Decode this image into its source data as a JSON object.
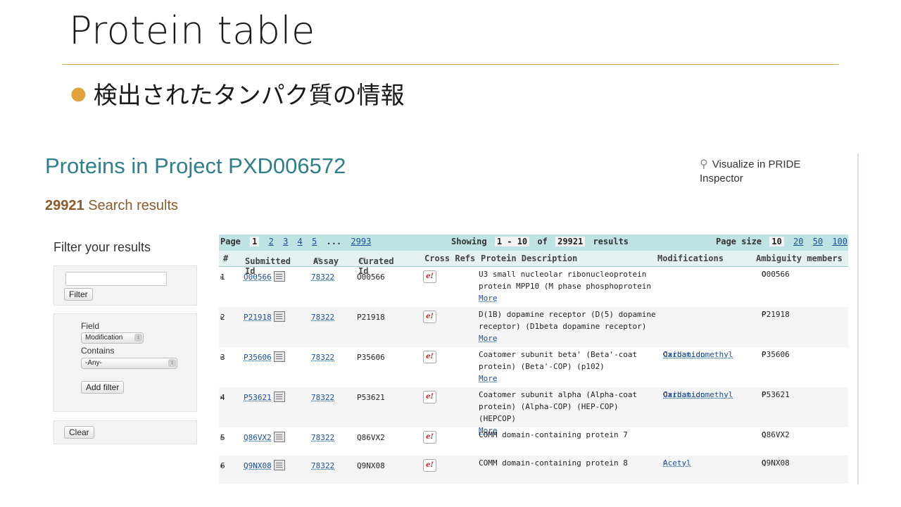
{
  "slide": {
    "title": "Protein table",
    "bullet": "検出されたタンパク質の情報"
  },
  "page": {
    "project_title": "Proteins in Project PXD006572",
    "visualize_label": "Visualize in PRIDE Inspector",
    "results_count": "29921",
    "results_label": "Search results"
  },
  "filters": {
    "heading": "Filter your results",
    "search_value": "",
    "filter_button": "Filter",
    "field_label": "Field",
    "field_value": "Modification",
    "contains_label": "Contains",
    "contains_value": "-Any-",
    "add_filter_button": "Add filter",
    "clear_button": "Clear"
  },
  "pager": {
    "page_label": "Page",
    "current_page": "1",
    "pages": [
      "2",
      "3",
      "4",
      "5"
    ],
    "ellipsis": "...",
    "last_page": "2993",
    "showing_label": "Showing",
    "range": "1 - 10",
    "of_label": "of",
    "total": "29921",
    "results_label": "results",
    "page_size_label": "Page size",
    "page_size_current": "10",
    "page_size_options": [
      "20",
      "50",
      "100"
    ]
  },
  "columns": {
    "num": "#",
    "submitted_id": "Submitted Id",
    "assay": "Assay",
    "curated_id": "Curated Id",
    "cross_refs": "Cross Refs",
    "description": "Protein Description",
    "modifications": "Modifications",
    "ambiguity": "Ambiguity members"
  },
  "rows": [
    {
      "num": "1",
      "submitted_id": "O00566",
      "assay": "78322",
      "curated_id": "O00566",
      "desc": "U3 small nucleolar ribonucleoprotein protein MPP10 (M phase phosphoprotein",
      "more": "More",
      "mods": [],
      "amb": "O00566"
    },
    {
      "num": "2",
      "submitted_id": "P21918",
      "assay": "78322",
      "curated_id": "P21918",
      "desc": "D(1B) dopamine receptor (D(5) dopamine receptor) (D1beta dopamine receptor)",
      "more": "More",
      "mods": [],
      "amb": "P21918"
    },
    {
      "num": "3",
      "submitted_id": "P35606",
      "assay": "78322",
      "curated_id": "P35606",
      "desc": "Coatomer subunit beta' (Beta'-coat protein) (Beta'-COP) (p102)",
      "more": "More",
      "mods": [
        "Carbamidomethyl",
        "Oxidation"
      ],
      "amb": "P35606"
    },
    {
      "num": "4",
      "submitted_id": "P53621",
      "assay": "78322",
      "curated_id": "P53621",
      "desc": "Coatomer subunit alpha (Alpha-coat protein) (Alpha-COP) (HEP-COP) (HEPCOP)",
      "more": "More",
      "mods": [
        "Carbamidomethyl",
        "Oxidation"
      ],
      "amb": "P53621"
    },
    {
      "num": "5",
      "submitted_id": "Q86VX2",
      "assay": "78322",
      "curated_id": "Q86VX2",
      "desc": "COMM domain-containing protein 7",
      "more": "",
      "mods": [],
      "amb": "Q86VX2"
    },
    {
      "num": "6",
      "submitted_id": "Q9NX08",
      "assay": "78322",
      "curated_id": "Q9NX08",
      "desc": "COMM domain-containing protein 8",
      "more": "",
      "mods": [
        "Acetyl"
      ],
      "amb": "Q9NX08"
    }
  ],
  "icons": {
    "search": "magnifier-icon",
    "row_expand": "triangle-right-icon",
    "id_details": "document-icon",
    "xref_uniprot": "puzzle-icon",
    "xref_ensembl": "e-icon"
  },
  "colors": {
    "accent_rule": "#d9a641",
    "project_title": "#2e7f8a",
    "results_count": "#8a5a2a",
    "pager_bg": "#bfe3e3",
    "link": "#1b4f9a"
  }
}
